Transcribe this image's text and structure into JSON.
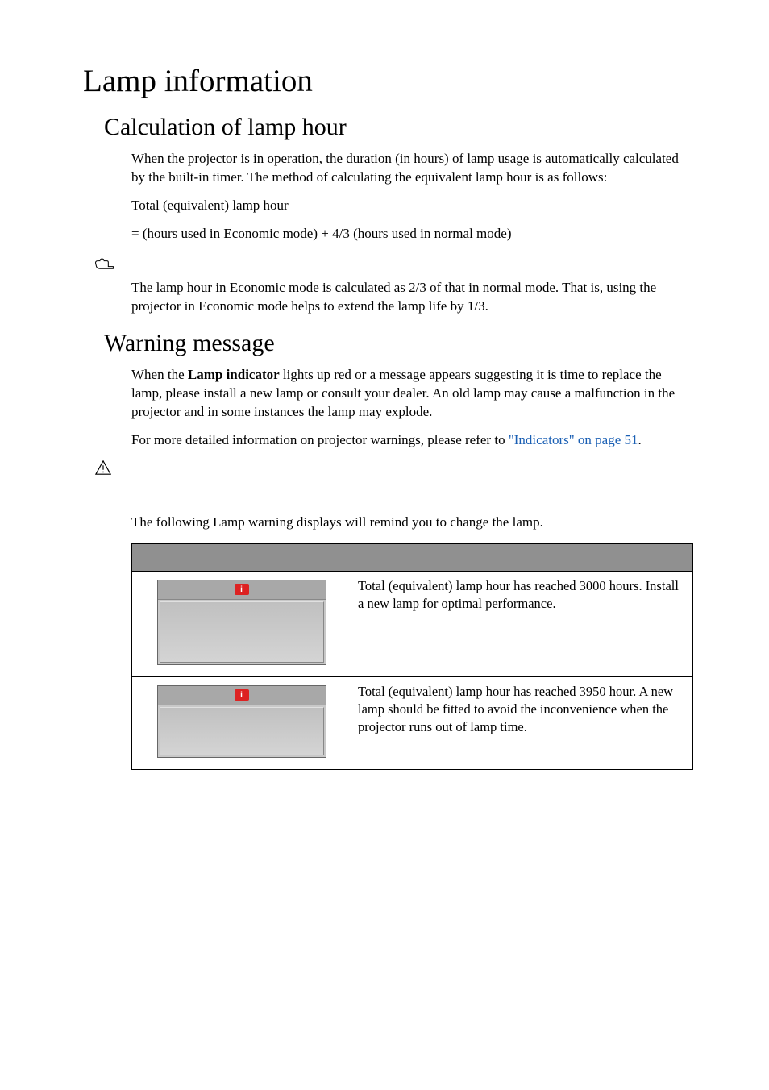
{
  "title": "Lamp information",
  "section1": {
    "heading": "Calculation of lamp hour",
    "para1": "When the projector is in operation, the duration (in hours) of lamp usage is automatically calculated by the built-in timer. The method of calculating the equivalent lamp hour is as follows:",
    "para2": "Total (equivalent) lamp hour",
    "para3": "=  (hours used in Economic mode) + 4/3 (hours used in normal mode)",
    "note": "The lamp hour in Economic mode is calculated as 2/3 of that in normal mode. That is, using the projector in Economic mode helps to extend the lamp life by 1/3."
  },
  "section2": {
    "heading": "Warning message",
    "para1_pre": "When the ",
    "para1_bold": "Lamp indicator",
    "para1_post": " lights up red or a message appears suggesting it is time to replace the lamp, please install a new lamp or consult your dealer. An old lamp may cause a malfunction in the projector and in some instances the lamp may explode.",
    "para2_pre": "For more detailed information on projector warnings, please refer to ",
    "para2_link": "\"Indicators\" on page 51",
    "para2_post": ".",
    "para3": "The following Lamp warning displays will remind you to change the lamp."
  },
  "table": {
    "row1_msg": "Total (equivalent) lamp hour has reached 3000 hours. Install a new lamp for optimal performance.",
    "row2_msg": "Total (equivalent) lamp hour has reached 3950 hour. A new lamp should be fitted to avoid the inconvenience when the projector runs out of lamp time."
  }
}
